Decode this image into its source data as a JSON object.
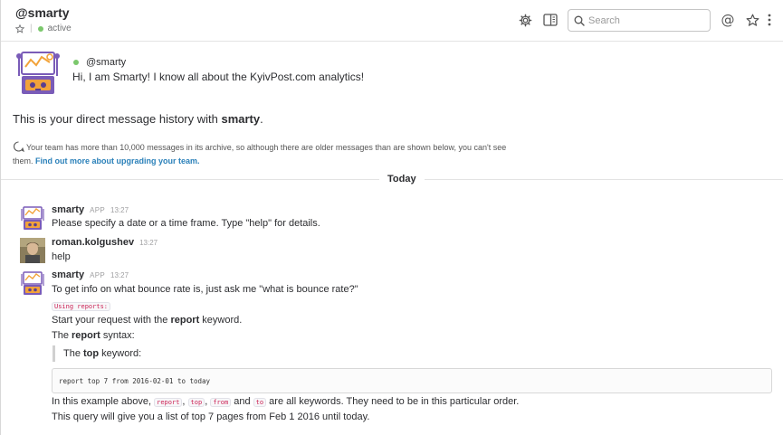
{
  "header": {
    "channel_name": "@smarty",
    "status": "active",
    "search_placeholder": "Search",
    "icons": [
      "gear-icon",
      "sidebar-toggle-icon",
      "search-icon",
      "mentions-icon",
      "star-icon",
      "more-icon"
    ]
  },
  "intro": {
    "bot_name": "@smarty",
    "greeting": "Hi, I am Smarty! I know all about the KyivPost.com analytics!",
    "dm_history_prefix": "This is your direct message history with ",
    "dm_history_user": "smarty",
    "dm_history_suffix": ".",
    "archive_note": "Your team has more than 10,000 messages in its archive, so although there are older messages than are shown below, you can't see them.",
    "archive_link": "Find out more about upgrading your team."
  },
  "divider": {
    "label": "Today"
  },
  "messages": [
    {
      "sender": "smarty",
      "badge": "APP",
      "time": "13:27",
      "text": "Please specify a date or a time frame. Type \"help\" for details."
    },
    {
      "sender": "roman.kolgushev",
      "time": "13:27",
      "text": "help"
    },
    {
      "sender": "smarty",
      "badge": "APP",
      "time": "13:27",
      "text": "To get info on what bounce rate is, just ask me \"what is bounce rate?\"",
      "inline_code_heading": "Using reports:",
      "line_start_prefix": "Start your request with the ",
      "line_start_keyword": "report",
      "line_start_suffix": " keyword.",
      "line_syntax_prefix": "The ",
      "line_syntax_keyword": "report",
      "line_syntax_suffix": " syntax:",
      "quote_prefix": "The ",
      "quote_keyword": "top",
      "quote_suffix": " keyword:",
      "code_block": "report top 7 from 2016-02-01 to today",
      "example_prefix": "In this example above, ",
      "kw1": "report",
      "comma1": ",",
      "kw2": "top",
      "comma2": ",",
      "kw3": "from",
      "and_word": "and",
      "kw4": "to",
      "example_suffix": "are all keywords. They need to be in this particular order.",
      "final_line": "This query will give you a list of top 7 pages from Feb 1 2016 until today."
    }
  ],
  "colors": {
    "status_dot": "#7bc86c",
    "link": "#2a80b9",
    "inline_code": "#cc2255",
    "text": "#2c2d30"
  }
}
